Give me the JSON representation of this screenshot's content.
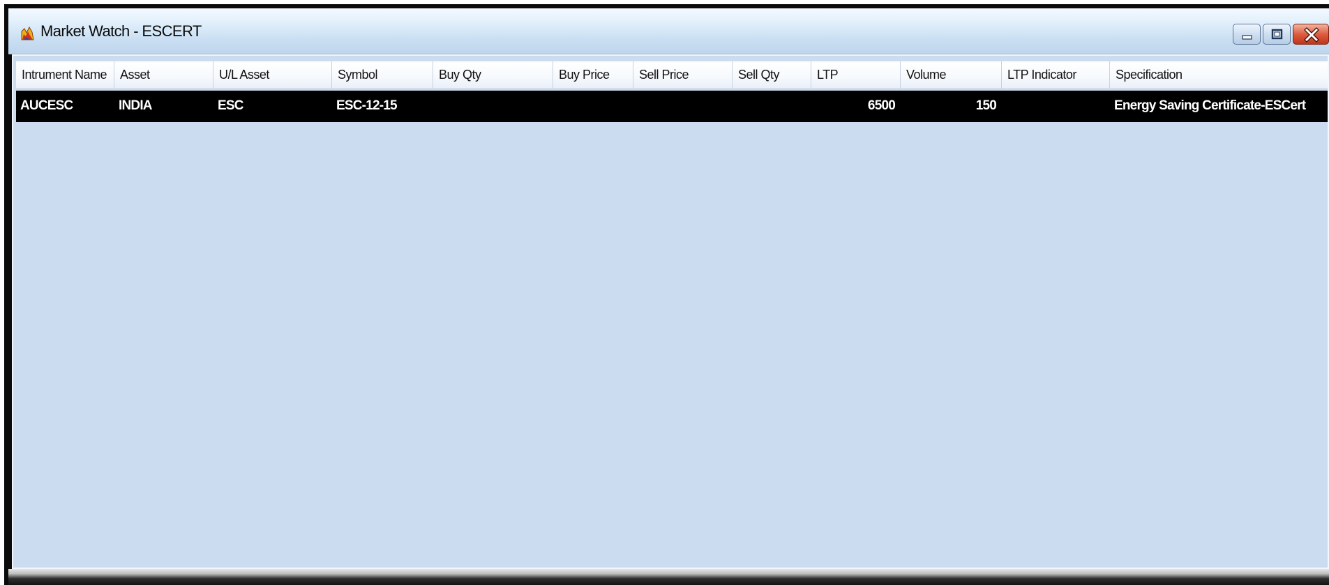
{
  "window": {
    "title": "Market Watch - ESCERT",
    "icon": "market-watch-app-icon",
    "controls": {
      "minimize_icon": "minimize-icon",
      "maximize_icon": "restore-icon",
      "close_icon": "close-icon",
      "close_color": "#d24a2c"
    }
  },
  "grid": {
    "columns": [
      "Intrument Name",
      "Asset",
      "U/L Asset",
      "Symbol",
      "Buy Qty",
      "Buy Price",
      "Sell Price",
      "Sell Qty",
      "LTP",
      "Volume",
      "LTP Indicator",
      "Specification"
    ],
    "rows": [
      {
        "instrument_name": "AUCESC",
        "asset": "INDIA",
        "ul_asset": "ESC",
        "symbol": "ESC-12-15",
        "buy_qty": "",
        "buy_price": "",
        "sell_price": "",
        "sell_qty": "",
        "ltp": "6500",
        "volume": "150",
        "ltp_indicator": "",
        "specification": "Energy Saving Certificate-ESCert",
        "selected": true
      }
    ],
    "colors": {
      "background": "#cbdcf0",
      "selected_row": "#000000",
      "selected_text": "#ffffff"
    }
  }
}
